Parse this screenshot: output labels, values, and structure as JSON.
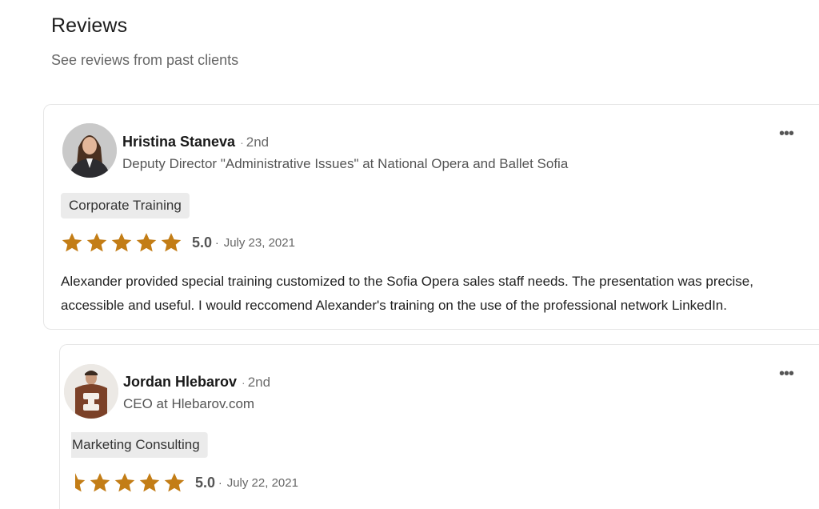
{
  "section": {
    "title": "Reviews",
    "subtitle": "See reviews from past clients"
  },
  "reviews": [
    {
      "name": "Hristina Staneva",
      "separator": "·",
      "degree": "2nd",
      "headline": "Deputy Director \"Administrative Issues\" at National Opera and Ballet Sofia",
      "service_tag": "Corporate Training",
      "rating": 5,
      "score_label": "5.0",
      "date": "July 23, 2021",
      "text": "Alexander provided special training customized to the Sofia Opera sales staff needs. The presentation was precise, accessible and useful. I would reccomend Alexander's training on the use of the professional network LinkedIn."
    },
    {
      "name": "Jordan Hlebarov",
      "separator": "·",
      "degree": "2nd",
      "headline": "CEO at Hlebarov.com",
      "service_tag": "Marketing Consulting",
      "rating": 5,
      "score_label": "5.0",
      "date": "July 22, 2021"
    }
  ],
  "icons": {
    "more": "more-horizontal-icon",
    "star": "star-icon"
  },
  "colors": {
    "star": "#c37d16",
    "tag_bg": "#ebebeb",
    "card_border": "#e6e6e6"
  }
}
